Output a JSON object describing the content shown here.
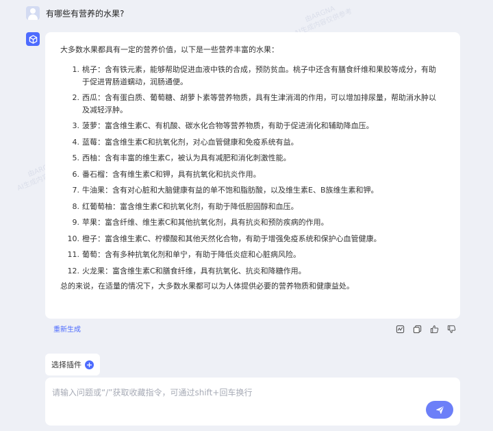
{
  "user": {
    "question": "有哪些有营养的水果?"
  },
  "answer": {
    "intro": "大多数水果都具有一定的营养价值，以下是一些营养丰富的水果：",
    "items": [
      {
        "num": "1.",
        "text": "桃子：含有铁元素，能够帮助促进血液中铁的合成，预防贫血。桃子中还含有膳食纤维和果胶等成分，有助于促进胃肠道蠕动，润肠通便。"
      },
      {
        "num": "2.",
        "text": "西瓜：含有蛋白质、葡萄糖、胡萝卜素等营养物质，具有生津消渴的作用，可以增加排尿量，帮助消水肿以及减轻浮肿。"
      },
      {
        "num": "3.",
        "text": "菠萝：富含维生素C、有机酸、碳水化合物等营养物质，有助于促进消化和辅助降血压。"
      },
      {
        "num": "4.",
        "text": "蓝莓：富含维生素C和抗氧化剂，对心血管健康和免疫系统有益。"
      },
      {
        "num": "5.",
        "text": "西柚：含有丰富的维生素C，被认为具有减肥和消化刺激性能。"
      },
      {
        "num": "6.",
        "text": "番石榴：含有维生素C和钾，具有抗氧化和抗炎作用。"
      },
      {
        "num": "7.",
        "text": "牛油果：含有对心脏和大脑健康有益的单不饱和脂肪酸，以及维生素E、B族维生素和钾。"
      },
      {
        "num": "8.",
        "text": "红葡萄柚：富含维生素C和抗氧化剂，有助于降低胆固醇和血压。"
      },
      {
        "num": "9.",
        "text": "苹果：富含纤维、维生素C和其他抗氧化剂，具有抗炎和预防疾病的作用。"
      },
      {
        "num": "10.",
        "text": "橙子：富含维生素C、柠檬酸和其他天然化合物，有助于增强免疫系统和保护心血管健康。"
      },
      {
        "num": "11.",
        "text": "葡萄：含有多种抗氧化剂和单宁，有助于降低炎症和心脏病风险。"
      },
      {
        "num": "12.",
        "text": "火龙果：富含维生素C和膳食纤维，具有抗氧化、抗炎和降糖作用。"
      }
    ],
    "summary": "总的来说，在适量的情况下，大多数水果都可以为人体提供必要的营养物质和健康益处。"
  },
  "actions": {
    "regenerate_label": "重新生成",
    "icons": [
      "chart-icon",
      "copy-icon",
      "thumbs-up-icon",
      "thumbs-down-icon"
    ]
  },
  "plugin": {
    "label": "选择插件"
  },
  "input": {
    "placeholder": "请输入问题或“/”获取收藏指令，可通过shift+回车换行",
    "value": ""
  },
  "watermark": {
    "line1": "由ARGNA",
    "line2": "AI生成内容仅供参考"
  },
  "colors": {
    "accent": "#4d6bfe",
    "send_button": "#6c7ff8",
    "background": "#eef0f6",
    "card": "#ffffff"
  }
}
